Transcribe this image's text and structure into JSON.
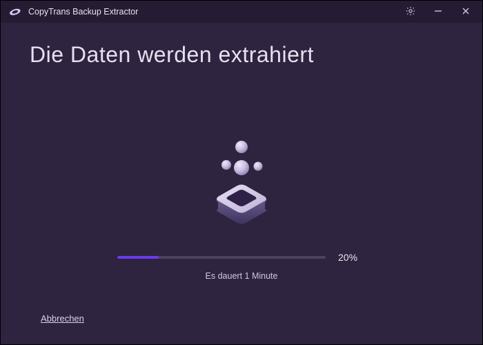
{
  "titlebar": {
    "app_name": "CopyTrans Backup Extractor",
    "icons": {
      "app": "app-logo-icon",
      "settings": "gear-icon",
      "minimize": "minimize-icon",
      "close": "close-icon"
    }
  },
  "main": {
    "heading": "Die Daten werden extrahiert",
    "progress_percent": 20,
    "progress_label": "20%",
    "eta_text": "Es dauert 1 Minute",
    "cancel_label": "Abbrechen"
  },
  "colors": {
    "accent": "#6a3af0",
    "window_bg": "#2e243f",
    "titlebar_bg": "#251c33"
  }
}
